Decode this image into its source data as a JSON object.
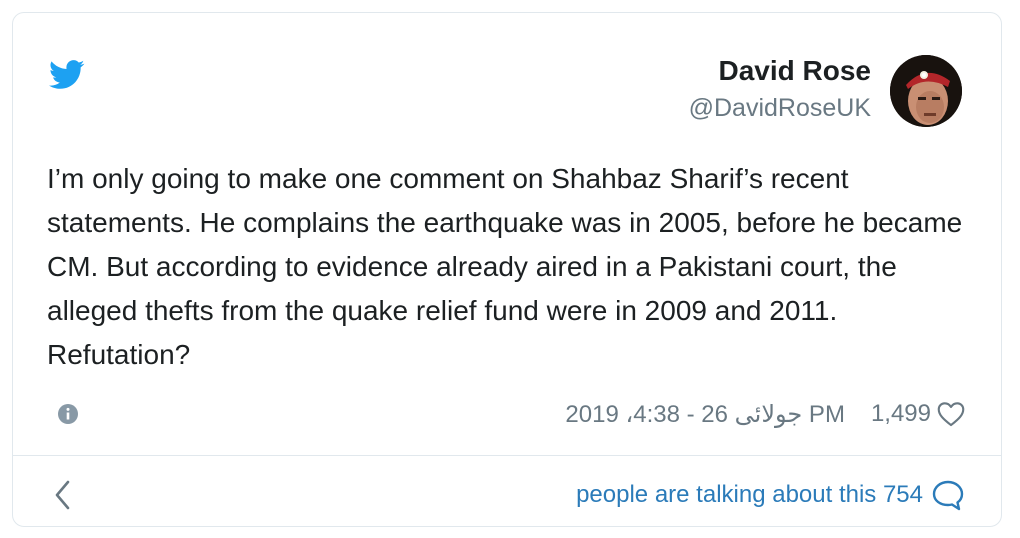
{
  "author": {
    "name": "David Rose",
    "handle": "@DavidRoseUK"
  },
  "tweet": {
    "text": "I’m only going to make one comment on Shahbaz Sharif’s recent statements. He complains the earthquake was in 2005, before he became CM. But according to evidence already aired in a Pakistani court, the alleged thefts from the quake relief fund were in 2009 and 2011. Refutation?"
  },
  "meta": {
    "timestamp": "2019 ،جولائی 26 - 4:38 PM",
    "like_count": "1,499"
  },
  "footer": {
    "talking_text": "people are talking about this 754"
  },
  "icons": {
    "logo": "twitter-bird-icon",
    "info": "info-icon",
    "like": "heart-icon",
    "back": "chevron-left-icon",
    "reply": "speech-bubble-icon"
  },
  "colors": {
    "brand": "#1da1f2",
    "text": "#1c2022",
    "muted": "#697882",
    "link": "#2b7bb9",
    "border": "#e1e8ed"
  }
}
